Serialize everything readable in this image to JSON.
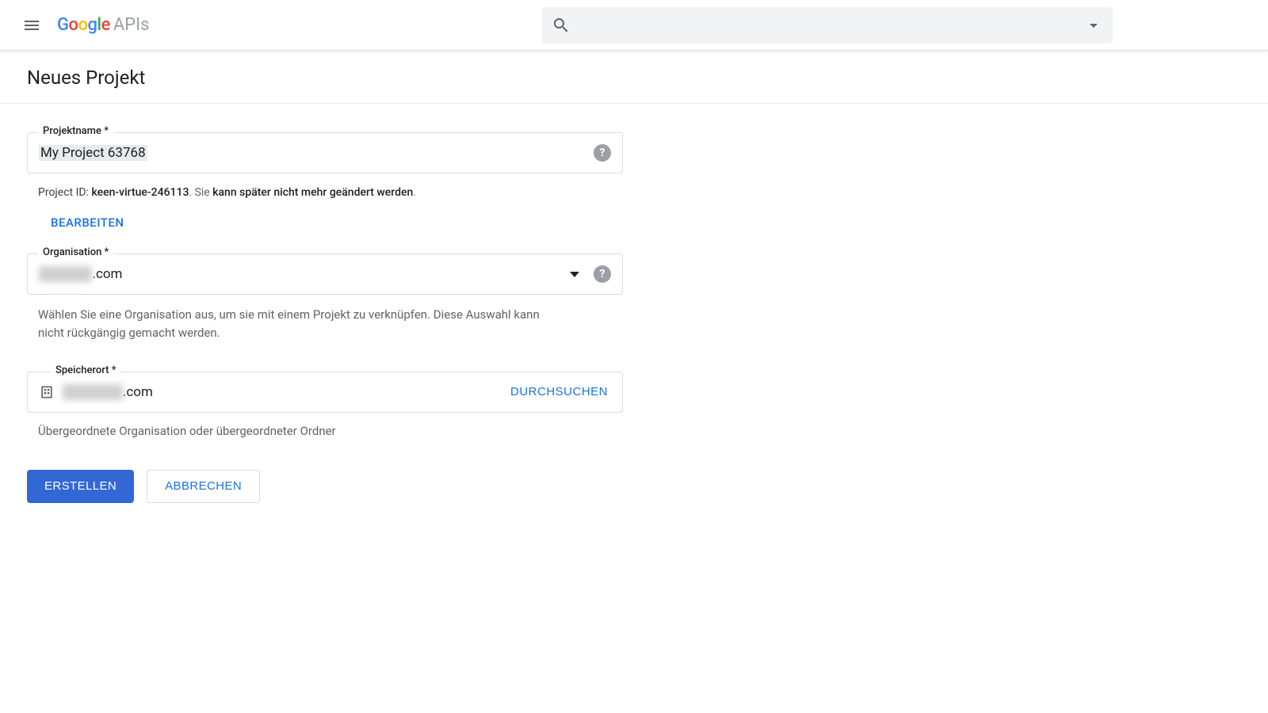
{
  "header": {
    "logo_brand": "Google",
    "logo_product": "APIs"
  },
  "page": {
    "title": "Neues Projekt"
  },
  "form": {
    "projectname": {
      "label": "Projektname *",
      "value": "My Project 63768"
    },
    "project_id_line": {
      "prefix": "Project ID: ",
      "id": "keen-virtue-246113",
      "after_id": ". ",
      "sie": "Sie ",
      "bold_rest": "kann später nicht mehr geändert werden",
      "period": "."
    },
    "edit_label": "BEARBEITEN",
    "organisation": {
      "label": "Organisation *",
      "value_hidden": "xxxxxxxx",
      "value_suffix": ".com",
      "helper": "Wählen Sie eine Organisation aus, um sie mit einem Projekt zu verknüpfen. Diese Auswahl kann nicht rückgängig gemacht werden."
    },
    "speicherort": {
      "label": "Speicherort *",
      "value_hidden": "xxxxxxxxx",
      "value_suffix": ".com",
      "browse_label": "DURCHSUCHEN",
      "helper": "Übergeordnete Organisation oder übergeordneter Ordner"
    },
    "actions": {
      "create": "ERSTELLEN",
      "cancel": "ABBRECHEN"
    }
  }
}
